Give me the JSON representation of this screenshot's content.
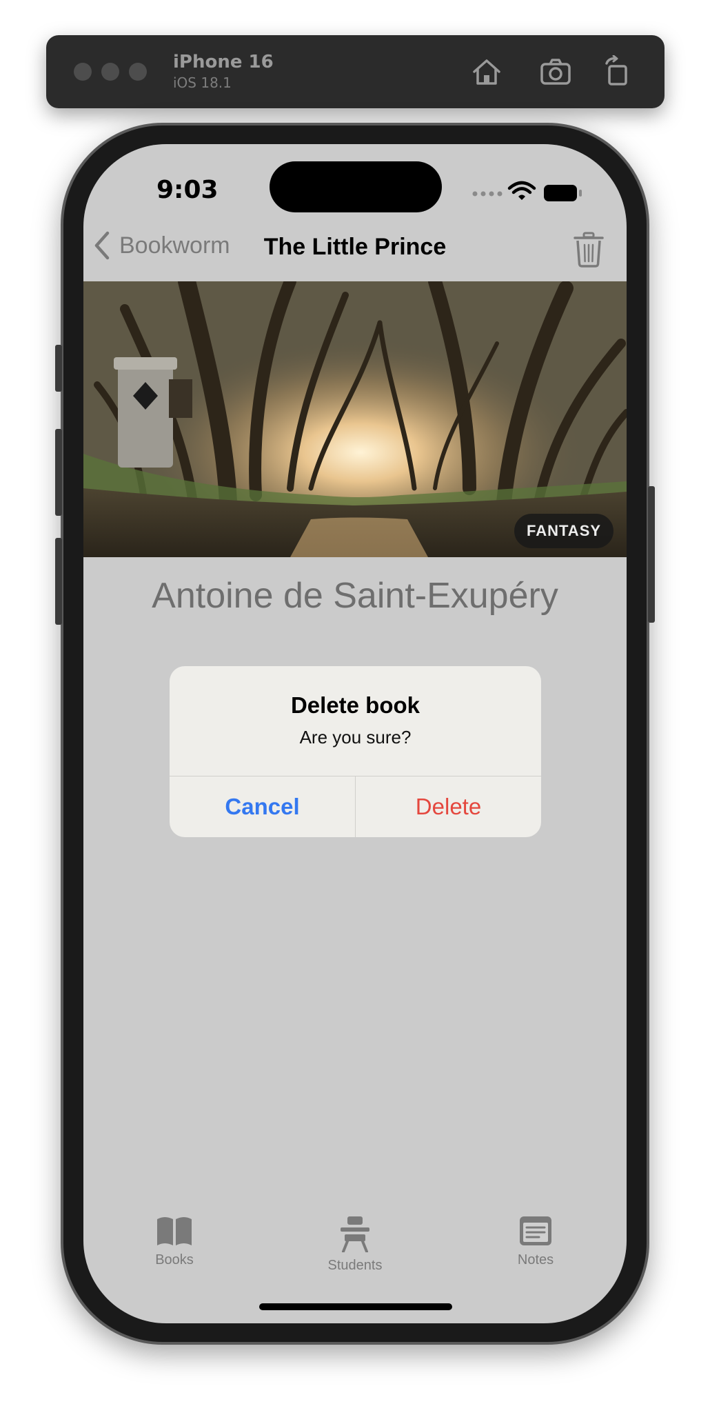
{
  "simulator": {
    "device_name": "iPhone 16",
    "os_version": "iOS 18.1",
    "toolbar_icons": [
      "home-icon",
      "screenshot-icon",
      "rotate-icon"
    ]
  },
  "status_bar": {
    "time": "9:03"
  },
  "nav": {
    "back_label": "Bookworm",
    "title": "The Little Prince"
  },
  "book": {
    "genre_badge": "FANTASY",
    "author": "Antoine de Saint-Exupéry"
  },
  "alert": {
    "title": "Delete book",
    "message": "Are you sure?",
    "cancel_label": "Cancel",
    "delete_label": "Delete"
  },
  "tab_bar": {
    "items": [
      {
        "label": "Books",
        "icon": "book-icon"
      },
      {
        "label": "Students",
        "icon": "school-desk-icon"
      },
      {
        "label": "Notes",
        "icon": "note-icon"
      }
    ]
  },
  "colors": {
    "accent_blue": "#3478f0",
    "destructive_red": "#e4473e",
    "screen_dimmed": "#cbcbcb",
    "alert_background": "#efeeea"
  }
}
